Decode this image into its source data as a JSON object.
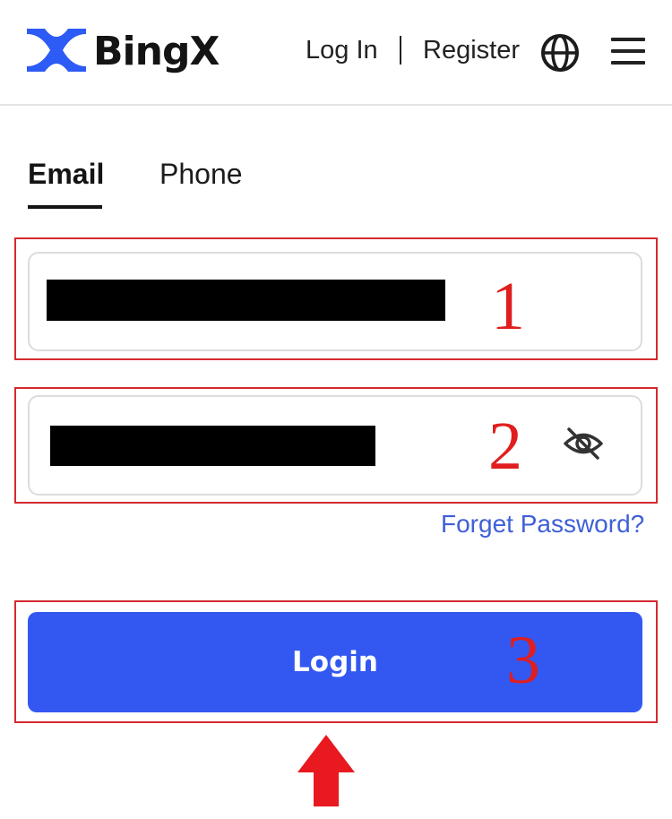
{
  "header": {
    "brand_name": "BingX",
    "login_label": "Log In",
    "register_label": "Register",
    "icons": [
      "bingx-logo-icon",
      "globe-icon",
      "hamburger-menu-icon"
    ]
  },
  "tabs": [
    {
      "label": "Email",
      "active": true
    },
    {
      "label": "Phone",
      "active": false
    }
  ],
  "form": {
    "email_value": "[redacted]",
    "password_value": "[redacted]",
    "password_toggle_icon": "eye-off-icon",
    "forget_password_label": "Forget Password?",
    "login_button_label": "Login"
  },
  "annotations": {
    "step_1": "1",
    "step_2": "2",
    "step_3": "3",
    "arrow_icon": "red-up-arrow-icon"
  },
  "colors": {
    "brand_blue": "#3358f2",
    "link_blue": "#3f5fd8",
    "annotation_red": "#d42a2f",
    "text_dark": "#141414"
  }
}
